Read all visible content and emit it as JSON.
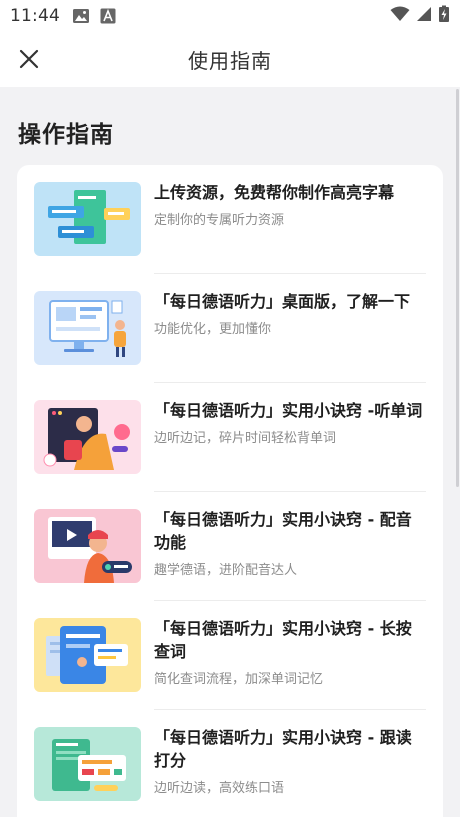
{
  "status_bar": {
    "time": "11:44",
    "left_icons": [
      "image-icon",
      "font-a-icon"
    ],
    "right_icons": [
      "wifi-icon",
      "signal-icon",
      "battery-charging-icon"
    ]
  },
  "header": {
    "title": "使用指南",
    "close_icon": "close-icon"
  },
  "main": {
    "section_title": "操作指南",
    "guides": [
      {
        "title": "上传资源，免费帮你制作高亮字幕",
        "subtitle": "定制你的专属听力资源",
        "thumb_color": "#bfe3f7"
      },
      {
        "title": "「每日德语听力」桌面版，了解一下",
        "subtitle": "功能优化，更加懂你",
        "thumb_color": "#d7e7fb"
      },
      {
        "title": "「每日德语听力」实用小诀窍 -听单词",
        "subtitle": "边听边记，碎片时间轻松背单词",
        "thumb_color": "#fde0ea"
      },
      {
        "title": "「每日德语听力」实用小诀窍 - 配音功能",
        "subtitle": "趣学德语，进阶配音达人",
        "thumb_color": "#f9c6d3"
      },
      {
        "title": "「每日德语听力」实用小诀窍 - 长按查词",
        "subtitle": "简化查词流程，加深单词记忆",
        "thumb_color": "#fde79b"
      },
      {
        "title": "「每日德语听力」实用小诀窍 - 跟读打分",
        "subtitle": "边听边读，高效练口语",
        "thumb_color": "#b7e8d9"
      }
    ]
  },
  "colors": {
    "background": "#f2f2f4",
    "card": "#ffffff",
    "title_text": "#1f1f1f",
    "subtitle_text": "#8c8c8c"
  }
}
